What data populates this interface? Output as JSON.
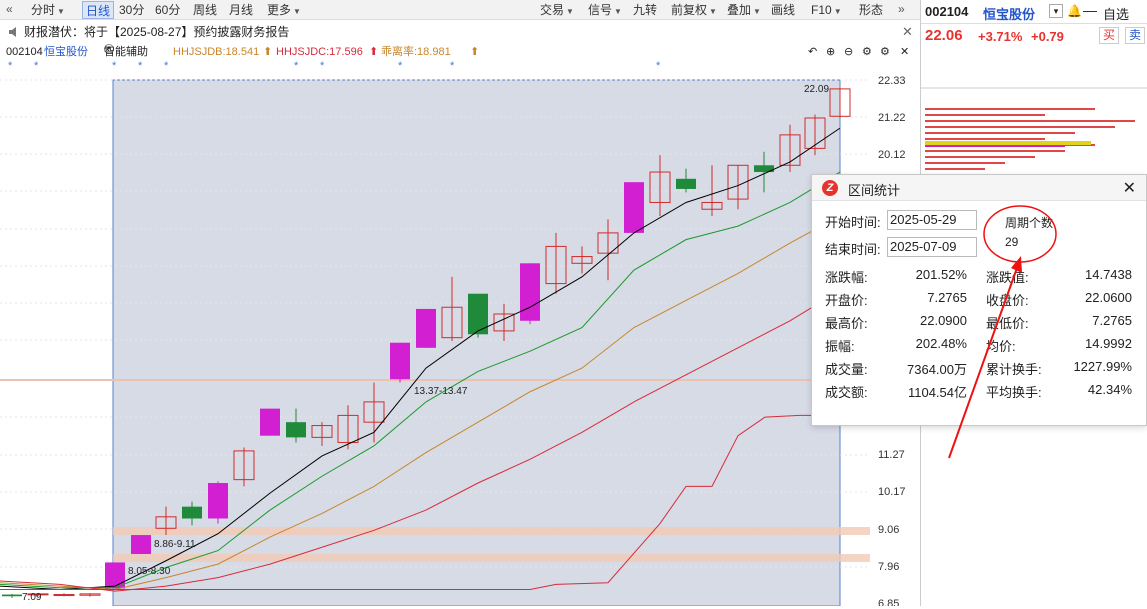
{
  "toolbar": {
    "left_items": [
      {
        "label": "分时",
        "arrow": true
      },
      {
        "label": "日线",
        "active": true
      },
      {
        "label": "30分"
      },
      {
        "label": "60分"
      },
      {
        "label": "周线"
      },
      {
        "label": "月线"
      },
      {
        "label": "更多",
        "arrow": true
      }
    ],
    "right_items": [
      {
        "label": "交易",
        "arrow": true
      },
      {
        "label": "信号",
        "arrow": true
      },
      {
        "label": "九转"
      },
      {
        "label": "前复权",
        "arrow": true
      },
      {
        "label": "叠加",
        "arrow": true
      },
      {
        "label": "画线"
      },
      {
        "label": "F10",
        "arrow": true
      },
      {
        "label": "形态"
      }
    ]
  },
  "notice": {
    "text": "财报潜伏：将于【2025-08-27】预约披露财务报告"
  },
  "indicators": {
    "code": "002104",
    "name": "恒宝股份",
    "assist": "智能辅助",
    "hhjsjdb": "HHJSJDB:18.541",
    "hhjsjdc": "HHJSJDC:17.596",
    "deviation": "乖离率:18.981"
  },
  "chart_data": {
    "type": "candlestick",
    "y_ticks": [
      "22.33",
      "21.22",
      "20.12",
      "11.27",
      "10.17",
      "9.06",
      "7.96",
      "6.85"
    ],
    "annotations": [
      "22.09",
      "13.37-13.47",
      "8.86-9.11",
      "8.05-8.30",
      "7.09"
    ],
    "colors": {
      "up": "#d12c2c",
      "down": "#1e8a3a",
      "limit_up": "#d21fd2",
      "ma5": "#000000",
      "ma10": "#1a9a2a",
      "ma20": "#c8862a",
      "ma60": "#d92a3a"
    }
  },
  "right_panel": {
    "code": "002104",
    "name": "恒宝股份",
    "watchlist": "自选",
    "price": "22.06",
    "pct": "+3.71%",
    "change": "+0.79",
    "buy": "买",
    "sell": "卖"
  },
  "dialog": {
    "title": "区间统计",
    "start_label": "开始时间:",
    "start_value": "2025-05-29",
    "end_label": "结束时间:",
    "end_value": "2025-07-09",
    "period_label": "周期个数",
    "period_value": "29",
    "stats": [
      {
        "label": "涨跌幅:",
        "value": "201.52%",
        "label2": "涨跌值:",
        "value2": "14.7438"
      },
      {
        "label": "开盘价:",
        "value": "7.2765",
        "label2": "收盘价:",
        "value2": "22.0600"
      },
      {
        "label": "最高价:",
        "value": "22.0900",
        "label2": "最低价:",
        "value2": "7.2765"
      },
      {
        "label": "振幅:",
        "value": "202.48%",
        "label2": "均价:",
        "value2": "14.9992"
      },
      {
        "label": "成交量:",
        "value": "7364.00万",
        "label2": "累计换手:",
        "value2": "1227.99%"
      },
      {
        "label": "成交额:",
        "value": "1104.54亿",
        "label2": "平均换手:",
        "value2": "42.34%"
      }
    ]
  }
}
